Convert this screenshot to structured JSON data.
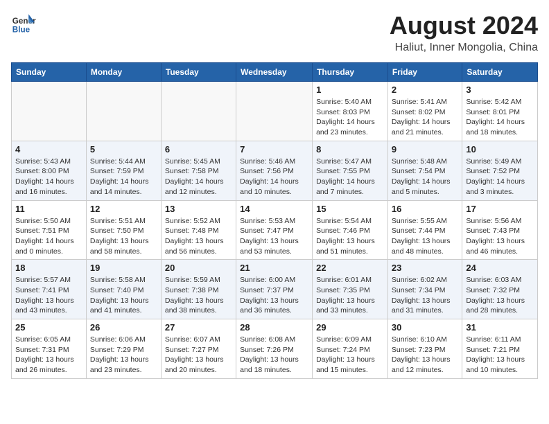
{
  "header": {
    "logo_line1": "General",
    "logo_line2": "Blue",
    "title": "August 2024",
    "subtitle": "Haliut, Inner Mongolia, China"
  },
  "weekdays": [
    "Sunday",
    "Monday",
    "Tuesday",
    "Wednesday",
    "Thursday",
    "Friday",
    "Saturday"
  ],
  "weeks": [
    {
      "row_shade": false,
      "days": [
        {
          "num": "",
          "info": ""
        },
        {
          "num": "",
          "info": ""
        },
        {
          "num": "",
          "info": ""
        },
        {
          "num": "",
          "info": ""
        },
        {
          "num": "1",
          "info": "Sunrise: 5:40 AM\nSunset: 8:03 PM\nDaylight: 14 hours\nand 23 minutes."
        },
        {
          "num": "2",
          "info": "Sunrise: 5:41 AM\nSunset: 8:02 PM\nDaylight: 14 hours\nand 21 minutes."
        },
        {
          "num": "3",
          "info": "Sunrise: 5:42 AM\nSunset: 8:01 PM\nDaylight: 14 hours\nand 18 minutes."
        }
      ]
    },
    {
      "row_shade": true,
      "days": [
        {
          "num": "4",
          "info": "Sunrise: 5:43 AM\nSunset: 8:00 PM\nDaylight: 14 hours\nand 16 minutes."
        },
        {
          "num": "5",
          "info": "Sunrise: 5:44 AM\nSunset: 7:59 PM\nDaylight: 14 hours\nand 14 minutes."
        },
        {
          "num": "6",
          "info": "Sunrise: 5:45 AM\nSunset: 7:58 PM\nDaylight: 14 hours\nand 12 minutes."
        },
        {
          "num": "7",
          "info": "Sunrise: 5:46 AM\nSunset: 7:56 PM\nDaylight: 14 hours\nand 10 minutes."
        },
        {
          "num": "8",
          "info": "Sunrise: 5:47 AM\nSunset: 7:55 PM\nDaylight: 14 hours\nand 7 minutes."
        },
        {
          "num": "9",
          "info": "Sunrise: 5:48 AM\nSunset: 7:54 PM\nDaylight: 14 hours\nand 5 minutes."
        },
        {
          "num": "10",
          "info": "Sunrise: 5:49 AM\nSunset: 7:52 PM\nDaylight: 14 hours\nand 3 minutes."
        }
      ]
    },
    {
      "row_shade": false,
      "days": [
        {
          "num": "11",
          "info": "Sunrise: 5:50 AM\nSunset: 7:51 PM\nDaylight: 14 hours\nand 0 minutes."
        },
        {
          "num": "12",
          "info": "Sunrise: 5:51 AM\nSunset: 7:50 PM\nDaylight: 13 hours\nand 58 minutes."
        },
        {
          "num": "13",
          "info": "Sunrise: 5:52 AM\nSunset: 7:48 PM\nDaylight: 13 hours\nand 56 minutes."
        },
        {
          "num": "14",
          "info": "Sunrise: 5:53 AM\nSunset: 7:47 PM\nDaylight: 13 hours\nand 53 minutes."
        },
        {
          "num": "15",
          "info": "Sunrise: 5:54 AM\nSunset: 7:46 PM\nDaylight: 13 hours\nand 51 minutes."
        },
        {
          "num": "16",
          "info": "Sunrise: 5:55 AM\nSunset: 7:44 PM\nDaylight: 13 hours\nand 48 minutes."
        },
        {
          "num": "17",
          "info": "Sunrise: 5:56 AM\nSunset: 7:43 PM\nDaylight: 13 hours\nand 46 minutes."
        }
      ]
    },
    {
      "row_shade": true,
      "days": [
        {
          "num": "18",
          "info": "Sunrise: 5:57 AM\nSunset: 7:41 PM\nDaylight: 13 hours\nand 43 minutes."
        },
        {
          "num": "19",
          "info": "Sunrise: 5:58 AM\nSunset: 7:40 PM\nDaylight: 13 hours\nand 41 minutes."
        },
        {
          "num": "20",
          "info": "Sunrise: 5:59 AM\nSunset: 7:38 PM\nDaylight: 13 hours\nand 38 minutes."
        },
        {
          "num": "21",
          "info": "Sunrise: 6:00 AM\nSunset: 7:37 PM\nDaylight: 13 hours\nand 36 minutes."
        },
        {
          "num": "22",
          "info": "Sunrise: 6:01 AM\nSunset: 7:35 PM\nDaylight: 13 hours\nand 33 minutes."
        },
        {
          "num": "23",
          "info": "Sunrise: 6:02 AM\nSunset: 7:34 PM\nDaylight: 13 hours\nand 31 minutes."
        },
        {
          "num": "24",
          "info": "Sunrise: 6:03 AM\nSunset: 7:32 PM\nDaylight: 13 hours\nand 28 minutes."
        }
      ]
    },
    {
      "row_shade": false,
      "days": [
        {
          "num": "25",
          "info": "Sunrise: 6:05 AM\nSunset: 7:31 PM\nDaylight: 13 hours\nand 26 minutes."
        },
        {
          "num": "26",
          "info": "Sunrise: 6:06 AM\nSunset: 7:29 PM\nDaylight: 13 hours\nand 23 minutes."
        },
        {
          "num": "27",
          "info": "Sunrise: 6:07 AM\nSunset: 7:27 PM\nDaylight: 13 hours\nand 20 minutes."
        },
        {
          "num": "28",
          "info": "Sunrise: 6:08 AM\nSunset: 7:26 PM\nDaylight: 13 hours\nand 18 minutes."
        },
        {
          "num": "29",
          "info": "Sunrise: 6:09 AM\nSunset: 7:24 PM\nDaylight: 13 hours\nand 15 minutes."
        },
        {
          "num": "30",
          "info": "Sunrise: 6:10 AM\nSunset: 7:23 PM\nDaylight: 13 hours\nand 12 minutes."
        },
        {
          "num": "31",
          "info": "Sunrise: 6:11 AM\nSunset: 7:21 PM\nDaylight: 13 hours\nand 10 minutes."
        }
      ]
    }
  ]
}
